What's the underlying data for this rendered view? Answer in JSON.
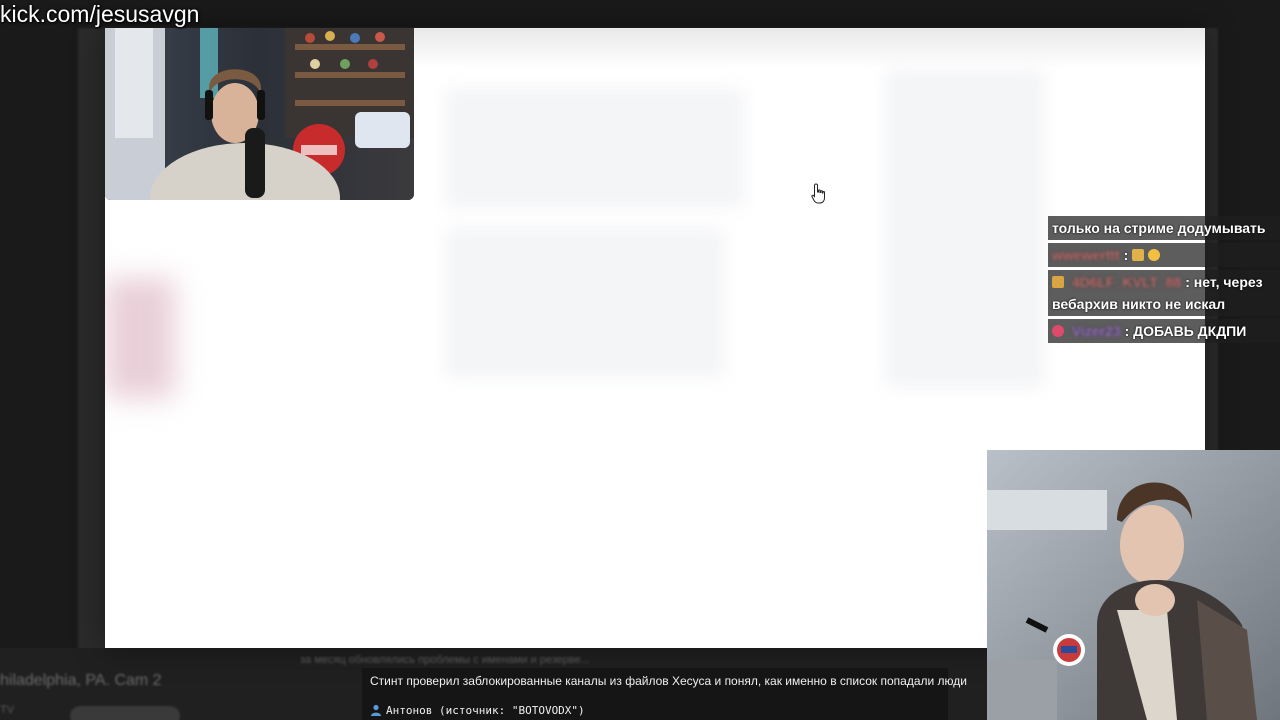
{
  "stream": {
    "url_watermark": "kick.com/jesusavgn"
  },
  "background_page": {
    "location_text": "hiladelphia, PA. Cam 2",
    "tv_text": "TV",
    "description_text": "за месяц обновлялись проблемы с именами и резерве..."
  },
  "chat": {
    "messages": [
      {
        "user": "",
        "text": "только на стриме додумывать",
        "user_color": "#9b8bd0",
        "badge": ""
      },
      {
        "user": "wwewerttt",
        "text": ":",
        "user_color": "#d07a7a",
        "badge": ""
      },
      {
        "user": "4D6LF_KVLT_88",
        "text": ": нет, через вебархив никто не искал",
        "user_color": "#d07a7a",
        "badge": "crown"
      },
      {
        "user": "Vizer23",
        "text": ": ДОБАВЬ ДКДПИ",
        "user_color": "#a77bd8",
        "badge": "heart"
      }
    ]
  },
  "ticker": {
    "headline": "Стинт проверил заблокированные каналы из файлов Хесуса и понял, как именно в список попадали люди",
    "source": "Антонов (источник: \"BOTOVODX\")"
  },
  "icons": {
    "cursor": "hand-pointer-icon",
    "person": "person-icon"
  },
  "colors": {
    "overlay_bg": "#ffffff",
    "page_bg": "#1a1a1b",
    "chat_bg": "rgba(30,30,30,0.72)"
  }
}
